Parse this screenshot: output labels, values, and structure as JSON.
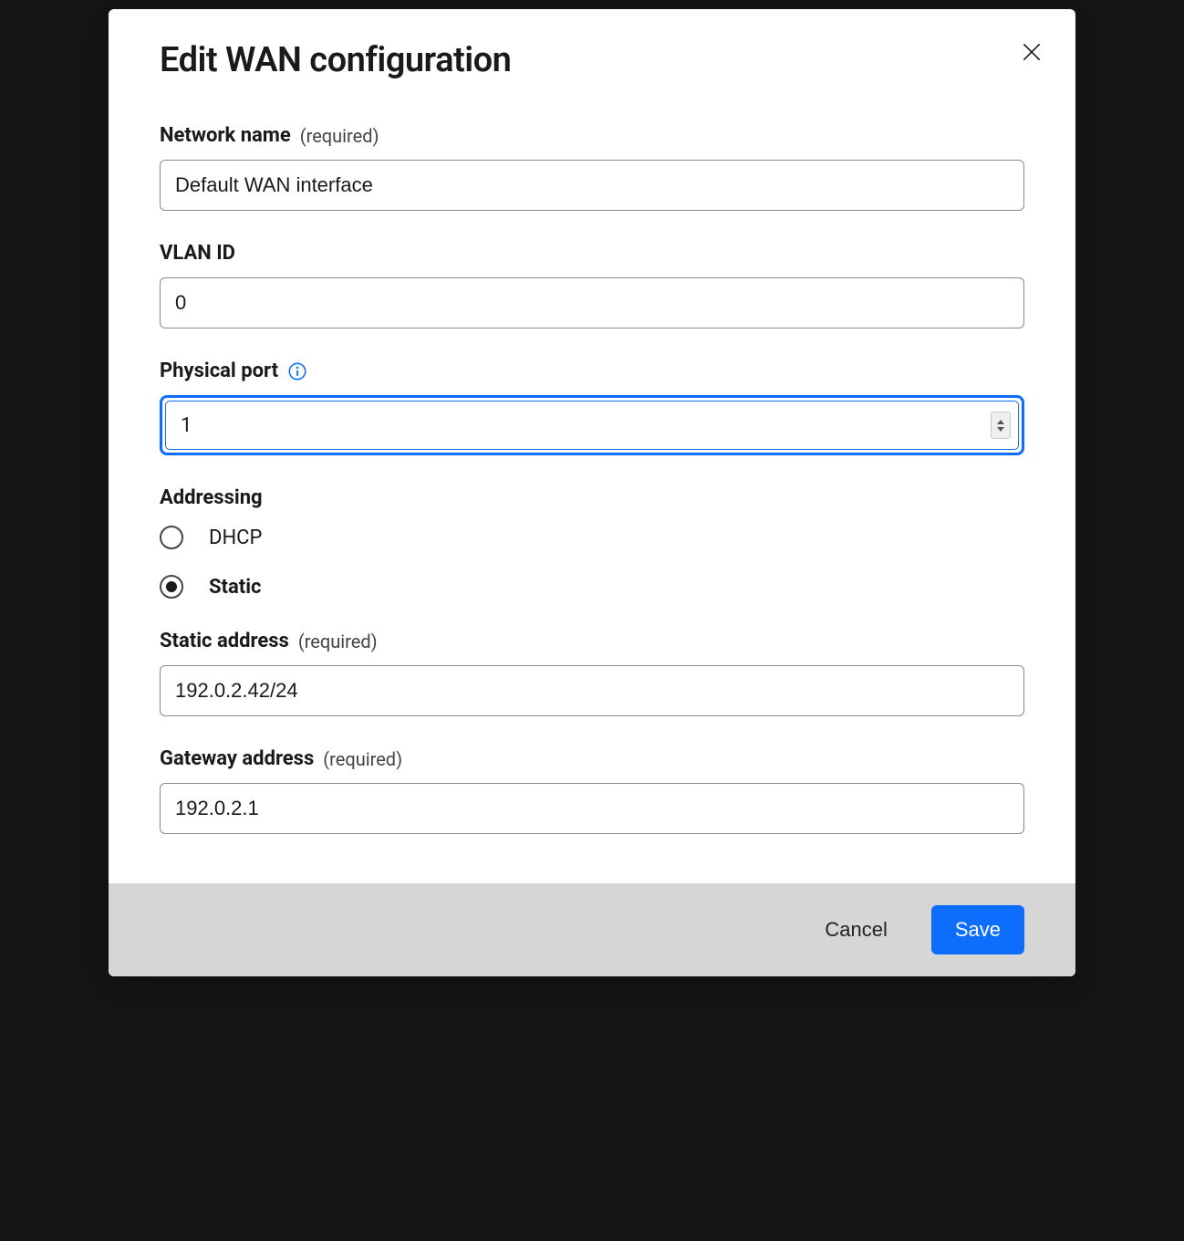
{
  "modal": {
    "title": "Edit WAN configuration",
    "fields": {
      "network_name": {
        "label": "Network name",
        "required_hint": "(required)",
        "value": "Default WAN interface"
      },
      "vlan_id": {
        "label": "VLAN ID",
        "value": "0"
      },
      "physical_port": {
        "label": "Physical port",
        "value": "1"
      },
      "addressing": {
        "label": "Addressing",
        "options": {
          "dhcp": "DHCP",
          "static": "Static"
        },
        "selected": "static"
      },
      "static_address": {
        "label": "Static address",
        "required_hint": "(required)",
        "value": "192.0.2.42/24"
      },
      "gateway_address": {
        "label": "Gateway address",
        "required_hint": "(required)",
        "value": "192.0.2.1"
      }
    },
    "footer": {
      "cancel": "Cancel",
      "save": "Save"
    }
  }
}
